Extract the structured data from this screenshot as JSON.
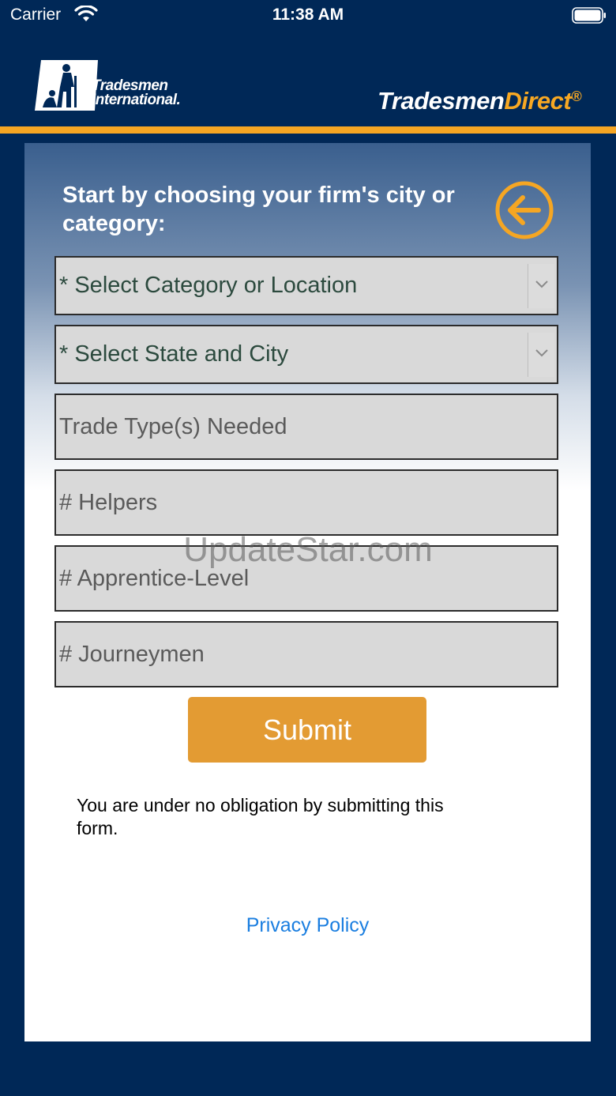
{
  "status_bar": {
    "carrier": "Carrier",
    "time": "11:38 AM",
    "wifi_icon": "wifi-icon",
    "battery_icon": "battery-icon"
  },
  "header": {
    "logo_line1": "Tradesmen",
    "logo_line2": "International.",
    "brand_part1": "Tradesmen",
    "brand_part2": "Direct",
    "brand_mark": "®"
  },
  "colors": {
    "background": "#002857",
    "accent": "#f5a623",
    "submit": "#e39b33",
    "link": "#1a7ee0"
  },
  "form": {
    "prompt": "Start by choosing your firm's city or category:",
    "back_icon": "arrow-left-circle-icon",
    "category_select": "* Select Category or Location",
    "state_city_select": "* Select State and City",
    "trade_type_placeholder": "Trade Type(s) Needed",
    "helpers_placeholder": "# Helpers",
    "apprentice_placeholder": "# Apprentice-Level",
    "journeymen_placeholder": "# Journeymen",
    "submit_label": "Submit",
    "disclaimer": "You are under no obligation by submitting this form.",
    "privacy_link": "Privacy Policy"
  },
  "watermark": "UpdateStar.com"
}
